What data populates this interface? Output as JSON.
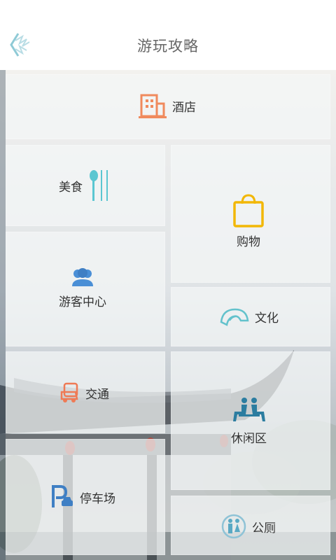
{
  "header": {
    "title": "游玩攻略"
  },
  "tiles": {
    "hotel": "酒店",
    "food": "美食",
    "shopping": "购物",
    "visitor_center": "游客中心",
    "culture": "文化",
    "transport": "交通",
    "leisure": "休闲区",
    "parking": "停车场",
    "toilet": "公厕"
  },
  "icons": {
    "back": "back-arrow-icon",
    "hotel": "building-icon",
    "food": "fork-knife-icon",
    "shopping": "shopping-bag-icon",
    "visitor_center": "people-icon",
    "culture": "fan-icon",
    "transport": "vehicle-icon",
    "leisure": "bench-people-icon",
    "parking": "parking-icon",
    "toilet": "restroom-icon"
  },
  "colors": {
    "hotel": "#f08a5d",
    "food": "#5bc6d1",
    "shopping": "#f2b705",
    "visitor_center": "#4a8fd6",
    "culture": "#63c2cc",
    "transport": "#ef7a55",
    "leisure": "#2c7da0",
    "parking": "#3f7fc4",
    "toilet": "#8fc3d6"
  }
}
